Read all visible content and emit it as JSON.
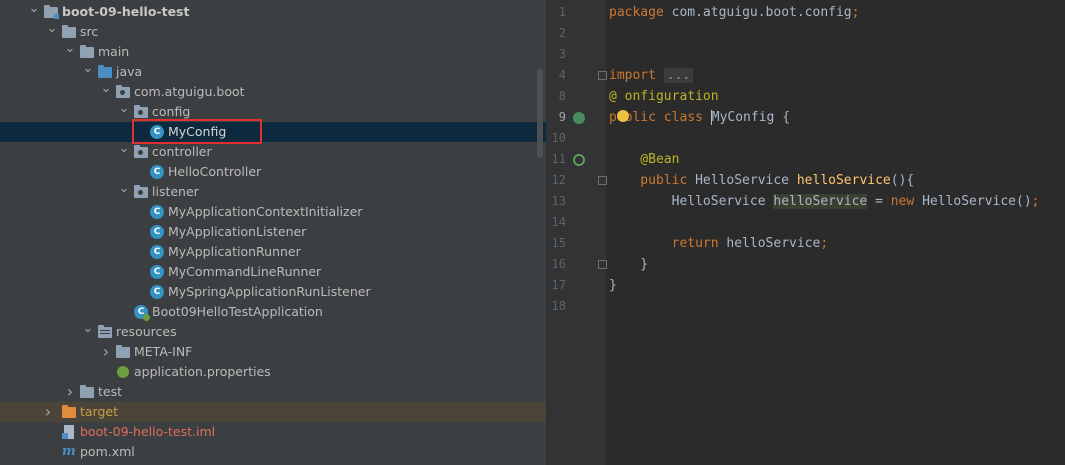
{
  "tree": {
    "items": [
      {
        "label": "boot-09-hello-test",
        "level": 0,
        "icon": "module-folder-icon",
        "expanded": true
      },
      {
        "label": "src",
        "level": 1,
        "icon": "folder-icon",
        "expanded": true
      },
      {
        "label": "main",
        "level": 2,
        "icon": "folder-icon",
        "expanded": true
      },
      {
        "label": "java",
        "level": 3,
        "icon": "source-root-icon",
        "expanded": true
      },
      {
        "label": "com.atguigu.boot",
        "level": 4,
        "icon": "package-icon",
        "expanded": true
      },
      {
        "label": "config",
        "level": 5,
        "icon": "package-icon",
        "expanded": true
      },
      {
        "label": "MyConfig",
        "level": 6,
        "icon": "class-icon",
        "selected": true
      },
      {
        "label": "controller",
        "level": 5,
        "icon": "package-icon",
        "expanded": true
      },
      {
        "label": "HelloController",
        "level": 6,
        "icon": "class-icon"
      },
      {
        "label": "listener",
        "level": 5,
        "icon": "package-icon",
        "expanded": true
      },
      {
        "label": "MyApplicationContextInitializer",
        "level": 6,
        "icon": "class-icon"
      },
      {
        "label": "MyApplicationListener",
        "level": 6,
        "icon": "class-icon"
      },
      {
        "label": "MyApplicationRunner",
        "level": 6,
        "icon": "class-icon"
      },
      {
        "label": "MyCommandLineRunner",
        "level": 6,
        "icon": "class-icon"
      },
      {
        "label": "MySpringApplicationRunListener",
        "level": 6,
        "icon": "class-icon"
      },
      {
        "label": "Boot09HelloTestApplication",
        "level": 5,
        "icon": "spring-boot-class-icon"
      },
      {
        "label": "resources",
        "level": 3,
        "icon": "resources-folder-icon",
        "expanded": true
      },
      {
        "label": "META-INF",
        "level": 4,
        "icon": "folder-icon",
        "expanded": false
      },
      {
        "label": "application.properties",
        "level": 4,
        "icon": "spring-properties-icon"
      },
      {
        "label": "test",
        "level": 2,
        "icon": "folder-icon",
        "expanded": false
      },
      {
        "label": "target",
        "level": 1,
        "icon": "target-folder-icon",
        "expanded": false,
        "excluded": true
      },
      {
        "label": "boot-09-hello-test.iml",
        "level": 1,
        "icon": "iml-file-icon"
      },
      {
        "label": "pom.xml",
        "level": 1,
        "icon": "maven-icon"
      }
    ]
  },
  "colors": {
    "tree_bg": "#3c3f41",
    "selected_bg": "#0d293e",
    "excluded_bg": "#4a4439",
    "target_text": "#c7a246",
    "iml_text": "#e06c5c",
    "highlight": "#e0302f",
    "keyword": "#cc7832",
    "annotation": "#bbb529",
    "method": "#ffc66d"
  },
  "editor": {
    "line_numbers": [
      "1",
      "2",
      "3",
      "4",
      "8",
      "9",
      "10",
      "11",
      "12",
      "13",
      "14",
      "15",
      "16",
      "17",
      "18"
    ],
    "lines": [
      [
        {
          "t": "package ",
          "c": "kw"
        },
        {
          "t": "com.atguigu.boot.config",
          "c": ""
        },
        {
          "t": ";",
          "c": "kw"
        }
      ],
      [],
      [],
      [
        {
          "t": "import ",
          "c": "kw"
        },
        {
          "t": "...",
          "c": "fold-text"
        }
      ],
      [
        {
          "t": "@",
          "c": "ann"
        },
        {
          "t": "C",
          "c": "ann-hidden"
        },
        {
          "t": "onfiguration",
          "c": "ann"
        }
      ],
      [
        {
          "t": "public class ",
          "c": "kw"
        },
        {
          "t": "MyConfig",
          "c": "caret-word"
        },
        {
          "t": " {",
          "c": ""
        }
      ],
      [],
      [
        {
          "t": "    @Bean",
          "c": "ann"
        }
      ],
      [
        {
          "t": "    public ",
          "c": "kw"
        },
        {
          "t": "HelloService ",
          "c": ""
        },
        {
          "t": "helloService",
          "c": "fn"
        },
        {
          "t": "(){",
          "c": ""
        }
      ],
      [
        {
          "t": "        HelloService ",
          "c": ""
        },
        {
          "t": "helloService",
          "c": "hl-var"
        },
        {
          "t": " = ",
          "c": ""
        },
        {
          "t": "new ",
          "c": "kw"
        },
        {
          "t": "HelloService()",
          "c": ""
        },
        {
          "t": ";",
          "c": "kw"
        }
      ],
      [],
      [
        {
          "t": "        return ",
          "c": "kw"
        },
        {
          "t": "helloService",
          "c": ""
        },
        {
          "t": ";",
          "c": "kw"
        }
      ],
      [
        {
          "t": "    }",
          "c": ""
        }
      ],
      [
        {
          "t": "}",
          "c": ""
        }
      ],
      []
    ]
  }
}
